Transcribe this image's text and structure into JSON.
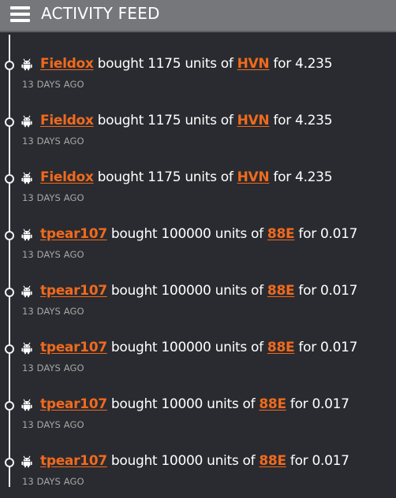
{
  "header": {
    "title": "ACTIVITY FEED"
  },
  "colors": {
    "background": "#2a2b30",
    "header": "#76777b",
    "accent": "#f06a1d",
    "timeline": "#f2f2f2",
    "muted": "#a6a6a6"
  },
  "feed": {
    "items": [
      {
        "user": "Fieldox",
        "action": "bought",
        "quantity": "1175",
        "units_word": "units of",
        "ticker": "HVN",
        "price_prefix": "for",
        "price": "4.235",
        "time": "13 DAYS AGO",
        "icon": "android-robot-icon"
      },
      {
        "user": "Fieldox",
        "action": "bought",
        "quantity": "1175",
        "units_word": "units of",
        "ticker": "HVN",
        "price_prefix": "for",
        "price": "4.235",
        "time": "13 DAYS AGO",
        "icon": "android-robot-icon"
      },
      {
        "user": "Fieldox",
        "action": "bought",
        "quantity": "1175",
        "units_word": "units of",
        "ticker": "HVN",
        "price_prefix": "for",
        "price": "4.235",
        "time": "13 DAYS AGO",
        "icon": "android-robot-icon"
      },
      {
        "user": "tpear107",
        "action": "bought",
        "quantity": "100000",
        "units_word": "units of",
        "ticker": "88E",
        "price_prefix": "for",
        "price": "0.017",
        "time": "13 DAYS AGO",
        "icon": "android-robot-icon"
      },
      {
        "user": "tpear107",
        "action": "bought",
        "quantity": "100000",
        "units_word": "units of",
        "ticker": "88E",
        "price_prefix": "for",
        "price": "0.017",
        "time": "13 DAYS AGO",
        "icon": "android-robot-icon"
      },
      {
        "user": "tpear107",
        "action": "bought",
        "quantity": "100000",
        "units_word": "units of",
        "ticker": "88E",
        "price_prefix": "for",
        "price": "0.017",
        "time": "13 DAYS AGO",
        "icon": "android-robot-icon"
      },
      {
        "user": "tpear107",
        "action": "bought",
        "quantity": "10000",
        "units_word": "units of",
        "ticker": "88E",
        "price_prefix": "for",
        "price": "0.017",
        "time": "13 DAYS AGO",
        "icon": "android-robot-icon"
      },
      {
        "user": "tpear107",
        "action": "bought",
        "quantity": "10000",
        "units_word": "units of",
        "ticker": "88E",
        "price_prefix": "for",
        "price": "0.017",
        "time": "13 DAYS AGO",
        "icon": "android-robot-icon"
      }
    ]
  }
}
